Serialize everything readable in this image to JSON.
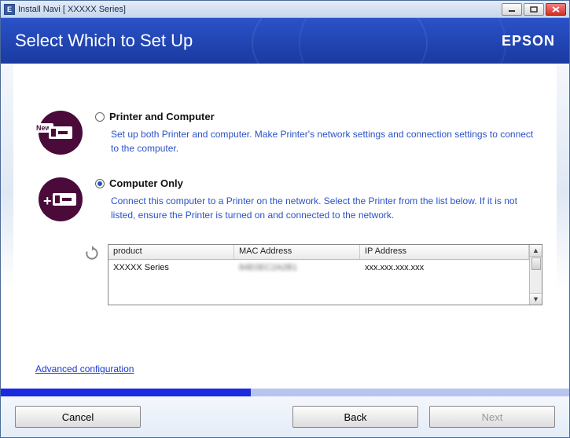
{
  "window": {
    "app_icon_letter": "E",
    "title": "Install Navi [ XXXXX     Series]"
  },
  "header": {
    "title": "Select Which to Set Up",
    "brand": "EPSON"
  },
  "options": {
    "opt1": {
      "badge": "New",
      "label": "Printer and Computer",
      "desc": "Set up both Printer and computer. Make Printer's network settings and connection settings to connect to the computer.",
      "selected": false
    },
    "opt2": {
      "badge": "+",
      "label": "Computer Only",
      "desc": "Connect this computer to a Printer on the network. Select the Printer from the list below. If it is not listed, ensure the Printer is turned on and connected to the network.",
      "selected": true
    }
  },
  "table": {
    "headers": {
      "c0": "product",
      "c1": "MAC Address",
      "c2": "IP Address"
    },
    "row": {
      "c0": "XXXXX  Series",
      "c1": "84E0EC2A2B1",
      "c2": "xxx.xxx.xxx.xxx"
    }
  },
  "advanced_link": "Advanced configuration",
  "buttons": {
    "cancel": "Cancel",
    "back": "Back",
    "next": "Next"
  }
}
